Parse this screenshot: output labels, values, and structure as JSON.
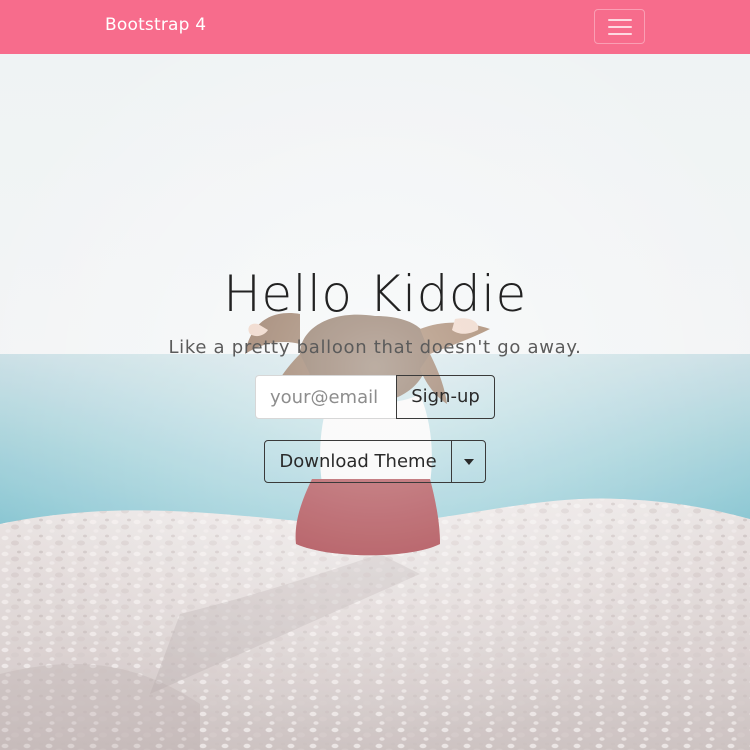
{
  "navbar": {
    "brand": "Bootstrap 4",
    "toggler_icon": "hamburger-menu-icon",
    "color": "#f76c8c"
  },
  "hero": {
    "background": "photo of a girl with flowing hair sitting on a white pebbled cliff overlooking the sea",
    "title": "Hello Kiddie",
    "subtitle": "Like a pretty balloon that doesn't go away.",
    "email_placeholder": "your@email",
    "signup_label": "Sign-up",
    "download_label": "Download Theme",
    "dropdown_icon": "caret-down-icon"
  }
}
